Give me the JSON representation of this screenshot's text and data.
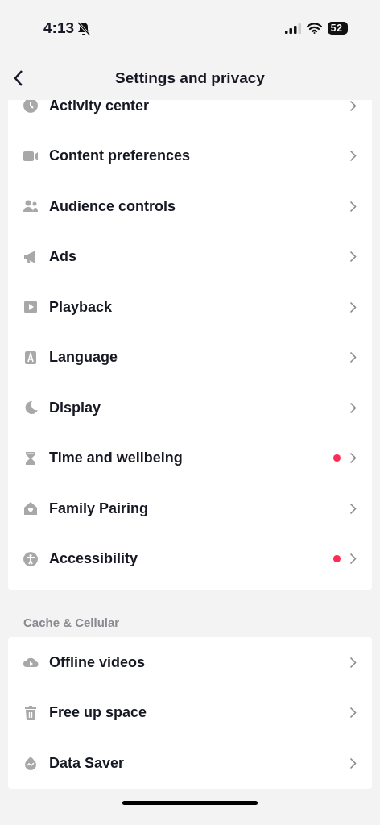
{
  "status_bar": {
    "time": "4:13",
    "battery": "52"
  },
  "header": {
    "title": "Settings and privacy"
  },
  "sections": [
    {
      "items": [
        {
          "label": "Activity center",
          "dot": false
        },
        {
          "label": "Content preferences",
          "dot": false
        },
        {
          "label": "Audience controls",
          "dot": false
        },
        {
          "label": "Ads",
          "dot": false
        },
        {
          "label": "Playback",
          "dot": false
        },
        {
          "label": "Language",
          "dot": false
        },
        {
          "label": "Display",
          "dot": false
        },
        {
          "label": "Time and wellbeing",
          "dot": true
        },
        {
          "label": "Family Pairing",
          "dot": false
        },
        {
          "label": "Accessibility",
          "dot": true
        }
      ]
    },
    {
      "title": "Cache & Cellular",
      "items": [
        {
          "label": "Offline videos",
          "dot": false
        },
        {
          "label": "Free up space",
          "dot": false
        },
        {
          "label": "Data Saver",
          "dot": false
        }
      ]
    }
  ]
}
